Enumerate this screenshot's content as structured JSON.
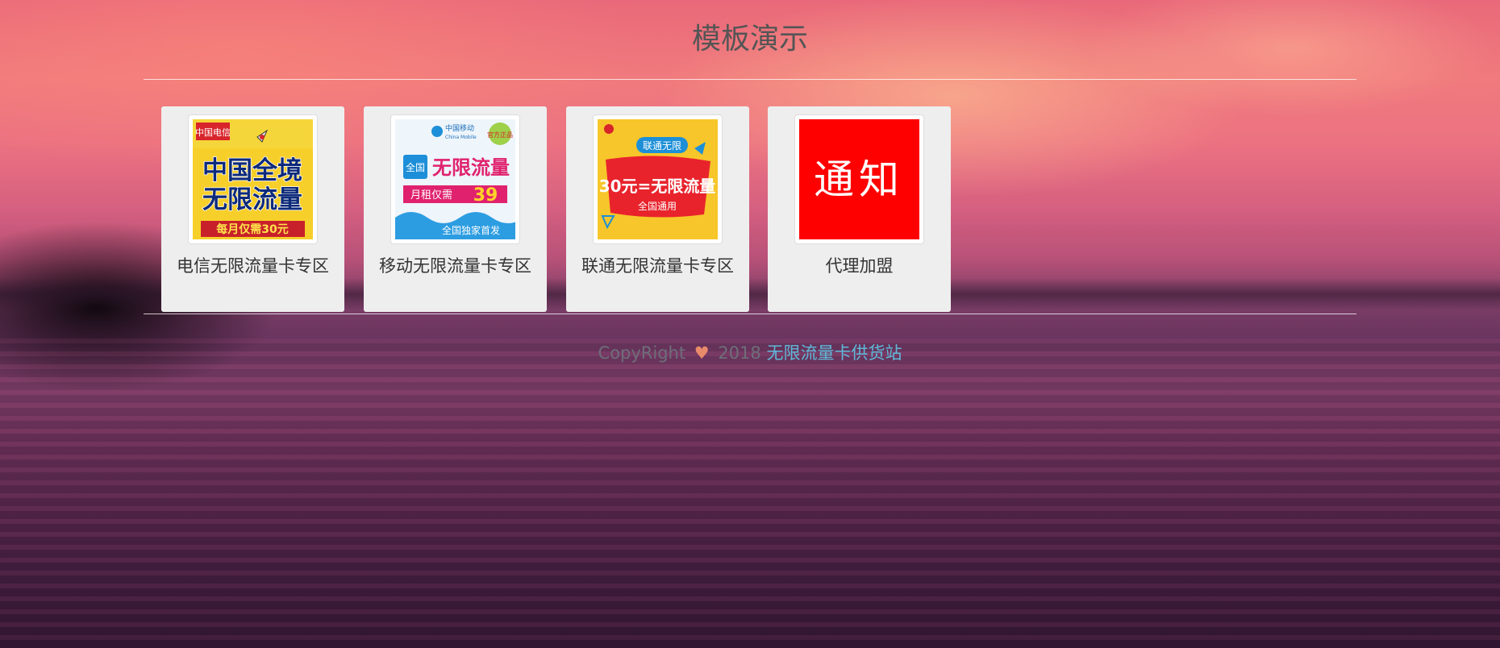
{
  "page": {
    "title": "模板演示"
  },
  "cards": [
    {
      "label": "电信无限流量卡专区",
      "image": {
        "brand": "中国电信",
        "line1": "中国全境",
        "line2": "无限流量",
        "badge": "每月仅需30元"
      }
    },
    {
      "label": "移动无限流量卡专区",
      "image": {
        "brand_cn": "中国移动",
        "brand_en": "China Mobile",
        "seal": "官方正品",
        "tag": "全国",
        "headline": "无限流量",
        "price_text": "月租仅需",
        "price": "39",
        "footer": "全国独家首发"
      }
    },
    {
      "label": "联通无限流量卡专区",
      "image": {
        "banner": "联通无限",
        "headline": "30元=无限流量",
        "footer": "全国通用"
      }
    },
    {
      "label": "代理加盟",
      "image": {
        "text": "通知"
      }
    }
  ],
  "footer": {
    "copyright": "CopyRight",
    "year": "2018",
    "site_name": "无限流量卡供货站"
  },
  "colors": {
    "heart": "#e98a6a",
    "link": "#5fb9d8",
    "card_bg": "#eeeeee",
    "notice_red": "#ff0000"
  }
}
